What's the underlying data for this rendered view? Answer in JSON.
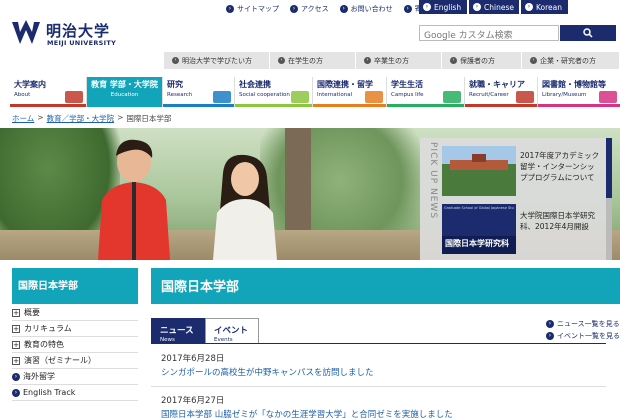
{
  "header": {
    "logo_jp": "明治大学",
    "logo_en": "MEIJI UNIVERSITY",
    "utility": [
      "サイトマップ",
      "アクセス",
      "お問い合わせ",
      "寄付"
    ],
    "languages": [
      "English",
      "Chinese",
      "Korean"
    ],
    "search_placeholder": "Google カスタム検索",
    "audience": [
      "明治大学で学びたい方",
      "在学生の方",
      "卒業生の方",
      "保護者の方",
      "企業・研究者の方"
    ]
  },
  "gnav": [
    {
      "jp": "大学案内",
      "en": "About",
      "color": "#c0392b"
    },
    {
      "jp": "教育 学部・大学院",
      "en": "Education",
      "color": "#12a4b9"
    },
    {
      "jp": "研究",
      "en": "Research",
      "color": "#1b7fc4"
    },
    {
      "jp": "社会連携",
      "en": "Social cooperation",
      "color": "#8cc63f"
    },
    {
      "jp": "国際連携・留学",
      "en": "International",
      "color": "#e67e22"
    },
    {
      "jp": "学生生活",
      "en": "Campus life",
      "color": "#27ae60"
    },
    {
      "jp": "就職・キャリア",
      "en": "Recruit/Career",
      "color": "#c0392b"
    },
    {
      "jp": "図書館・博物館等",
      "en": "Library/Museum",
      "color": "#d63384"
    }
  ],
  "breadcrumb": {
    "home": "ホーム",
    "education": "教育／学部・大学院",
    "current": "国際日本学部",
    "sep": ">"
  },
  "pickup": {
    "label": "PICK UP NEWS",
    "items": [
      "2017年度アカデミック留学・インターンシッププログラムについて",
      "大学院国際日本学研究科、2012年4月開設"
    ],
    "thumb2_text": "国際日本学研究科",
    "thumb2_caption": "Graduate School of Global Japanese Studies"
  },
  "sidebar": {
    "title": "国際日本学部",
    "items": [
      "概要",
      "カリキュラム",
      "教育の特色",
      "演習（ゼミナール）",
      "海外留学",
      "English Track"
    ]
  },
  "main": {
    "title": "国際日本学部",
    "tabs": [
      {
        "jp": "ニュース",
        "en": "News"
      },
      {
        "jp": "イベント",
        "en": "Events"
      }
    ],
    "more_news": "ニュース一覧を見る",
    "more_events": "イベント一覧を見る",
    "news": [
      {
        "date": "2017年6月28日",
        "title": "シンガポールの高校生が中野キャンパスを訪問しました"
      },
      {
        "date": "2017年6月27日",
        "title": "国際日本学部 山脇ゼミが「なかの生涯学習大学」と合同ゼミを実施しました"
      }
    ]
  }
}
